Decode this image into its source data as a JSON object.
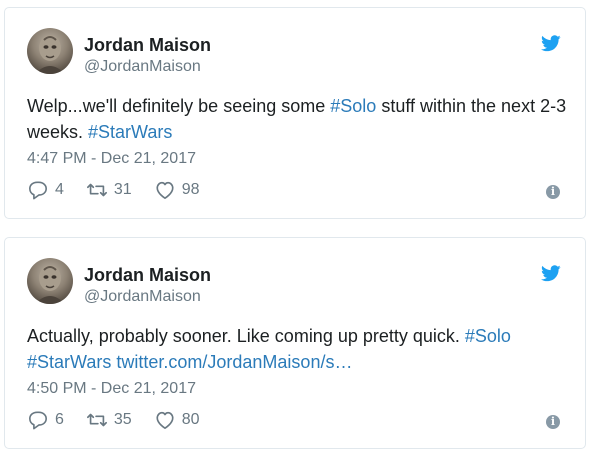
{
  "tweets": [
    {
      "author_name": "Jordan Maison",
      "author_handle": "@JordanMaison",
      "text_parts": {
        "p1": "Welp...we'll definitely be seeing some ",
        "h1": "#Solo",
        "p2": " stuff within the next 2-3 weeks. ",
        "h2": "#StarWars"
      },
      "timestamp": "4:47 PM - Dec 21, 2017",
      "replies": "4",
      "retweets": "31",
      "likes": "98"
    },
    {
      "author_name": "Jordan Maison",
      "author_handle": "@JordanMaison",
      "text_parts": {
        "p1": "Actually, probably sooner. Like coming up pretty quick. ",
        "h1": "#Solo",
        "p2": " ",
        "h2": "#StarWars",
        "p3": " ",
        "link": "twitter.com/JordanMaison/s…"
      },
      "timestamp": "4:50 PM - Dec 21, 2017",
      "replies": "6",
      "retweets": "35",
      "likes": "80"
    }
  ],
  "colors": {
    "link": "#2b7bb9",
    "twitter_blue": "#1da1f2",
    "muted": "#697882",
    "border": "#e1e8ed"
  },
  "icons": [
    "avatar",
    "twitter-bird-icon",
    "reply-icon",
    "retweet-icon",
    "like-icon",
    "info-icon"
  ]
}
